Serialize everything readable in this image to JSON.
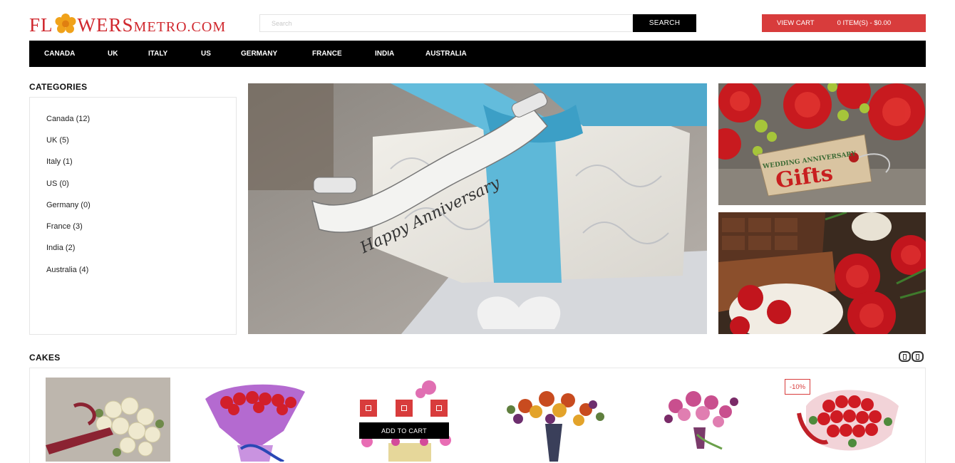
{
  "header": {
    "logo": {
      "part1": "FL",
      "part2": "WERS",
      "part3": "METRO.COM"
    },
    "search": {
      "placeholder": "Search",
      "button_label": "SEARCH"
    },
    "cart": {
      "view_label": "VIEW CART",
      "items_label": "0 ITEM(S) - $0.00"
    }
  },
  "nav": {
    "items": [
      {
        "label": "CANADA"
      },
      {
        "label": "UK"
      },
      {
        "label": "ITALY"
      },
      {
        "label": "US"
      },
      {
        "label": "GERMANY"
      },
      {
        "label": "FRANCE"
      },
      {
        "label": "INDIA"
      },
      {
        "label": "AUSTRALIA"
      }
    ]
  },
  "categories": {
    "title": "CATEGORIES",
    "items": [
      {
        "label": "Canada (12)"
      },
      {
        "label": "UK (5)"
      },
      {
        "label": "Italy (1)"
      },
      {
        "label": "US (0)"
      },
      {
        "label": "Germany (0)"
      },
      {
        "label": "France (3)"
      },
      {
        "label": "India (2)"
      },
      {
        "label": "Australia (4)"
      }
    ]
  },
  "banners": {
    "main_ribbon_text": "Happy Anniversary",
    "tag_top_text": "WEDDING ANNIVERSARY",
    "tag_main_text": "Gifts"
  },
  "cakes": {
    "title": "CAKES",
    "add_to_cart_label": "ADD TO CART",
    "discount_badge": "-10%"
  },
  "colors": {
    "brand_red": "#d83c3c",
    "logo_red": "#d0282e",
    "nav_black": "#000000"
  }
}
